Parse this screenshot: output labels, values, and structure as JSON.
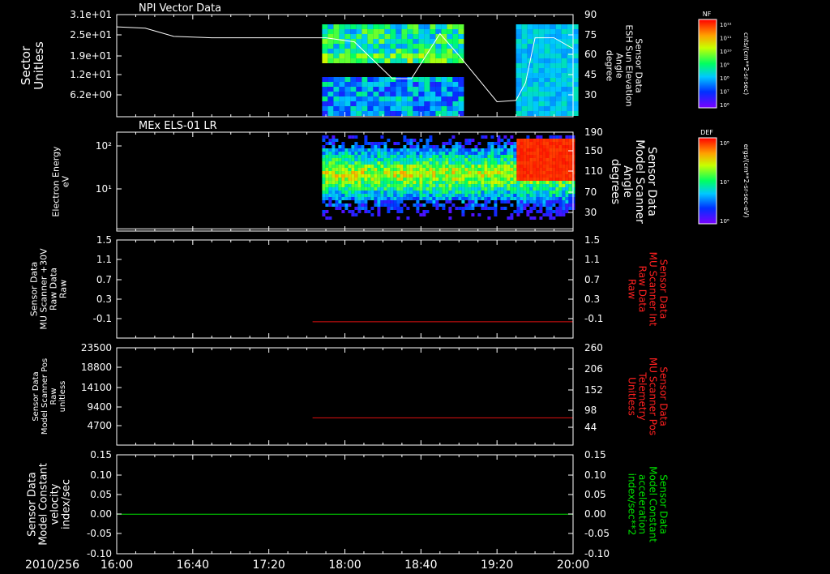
{
  "date_label": "2010/256",
  "x_ticks": [
    "16:00",
    "16:40",
    "17:20",
    "18:00",
    "18:40",
    "19:20",
    "20:00"
  ],
  "colors": {
    "background": "#000000",
    "axes": "#ffffff",
    "red_trace": "#e01010",
    "green_trace": "#00e000",
    "green_label": "#00e000",
    "red_label": "#ff2020"
  },
  "panels": [
    {
      "title": "NPI Vector Data",
      "left_label": [
        "Sector",
        "Unitless"
      ],
      "left_ticks": [
        "3.1e+01",
        "2.5e+01",
        "1.9e+01",
        "1.2e+01",
        "6.2e+00"
      ],
      "right_label": [
        "Sensor Data",
        "ESH Sun Elevation",
        "Angle",
        "degree"
      ],
      "right_ticks": [
        "90",
        "75",
        "60",
        "45",
        "30"
      ],
      "colorbar": {
        "label": "NF",
        "ticks": [
          "10¹²",
          "10¹¹",
          "10¹⁰",
          "10⁹",
          "10⁸",
          "10⁷",
          "10⁶"
        ],
        "units": "cnts/(cm**2-sr-sec)"
      }
    },
    {
      "title": "MEx ELS-01 LR",
      "left_label": [
        "Electron Energy",
        "eV"
      ],
      "left_ticks": [
        "10²",
        "10¹"
      ],
      "right_label": [
        "Sensor Data",
        "Model Scanner",
        "Angle",
        "degrees"
      ],
      "right_ticks": [
        "190",
        "150",
        "110",
        "70",
        "30"
      ],
      "colorbar": {
        "label": "DEF",
        "ticks": [
          "10⁸",
          "10⁷",
          "10⁶"
        ],
        "units": "ergs/(cm**2-sr-sec-eV)"
      }
    },
    {
      "title": "",
      "left_label": [
        "Sensor Data",
        "MU Scanner +30V",
        "Raw Data",
        "Raw"
      ],
      "left_ticks": [
        "1.5",
        "1.1",
        "0.7",
        "0.3",
        "-0.1"
      ],
      "right_label": [
        "Sensor Data",
        "MU Scanner Int",
        "Raw Data",
        "Raw"
      ],
      "right_ticks": [
        "1.5",
        "1.1",
        "0.7",
        "0.3",
        "-0.1"
      ]
    },
    {
      "title": "",
      "left_label": [
        "Sensor Data",
        "Model Scanner Pos",
        "Raw",
        "unitless"
      ],
      "left_ticks": [
        "23500",
        "18800",
        "14100",
        "9400",
        "4700"
      ],
      "right_label": [
        "Sensor Data",
        "MU Scanner Pos",
        "Telemetry",
        "Unitless"
      ],
      "right_ticks": [
        "260",
        "206",
        "152",
        "98",
        "44"
      ]
    },
    {
      "title": "",
      "left_label": [
        "Sensor Data",
        "Model Constant",
        "velocity",
        "index/sec"
      ],
      "left_ticks": [
        "0.15",
        "0.10",
        "0.05",
        "0.00",
        "-0.05",
        "-0.10"
      ],
      "right_label": [
        "Sensor Data",
        "Model Constant",
        "acceleration",
        "index/sec**2"
      ],
      "right_ticks": [
        "0.15",
        "0.10",
        "0.05",
        "0.00",
        "-0.05",
        "-0.10"
      ]
    }
  ],
  "chart_data": [
    {
      "type": "heatmap",
      "title": "NPI Vector Data",
      "x_range": [
        "16:00",
        "20:00"
      ],
      "y_ticks": [
        "3.1e+01",
        "2.5e+01",
        "1.9e+01",
        "1.2e+01",
        "6.2e+00"
      ],
      "data_windows": [
        [
          "17:48",
          "19:00"
        ],
        [
          "19:30",
          "20:00"
        ]
      ],
      "overlay_line": {
        "name": "ESH Sun Elevation Angle",
        "y_range": [
          15,
          90
        ],
        "x": [
          "16:00",
          "16:15",
          "16:30",
          "16:50",
          "17:50",
          "18:05",
          "18:25",
          "18:35",
          "18:50",
          "19:00",
          "19:20",
          "19:30",
          "19:35",
          "19:40",
          "19:50",
          "20:00"
        ],
        "y": [
          81,
          80,
          74,
          73,
          73,
          70,
          43,
          43,
          76,
          60,
          26,
          27,
          40,
          73,
          73,
          65
        ]
      }
    },
    {
      "type": "heatmap",
      "title": "MEx ELS-01 LR",
      "x_range": [
        "16:00",
        "20:00"
      ],
      "data_window": [
        "17:48",
        "20:00"
      ],
      "overlay_line": {
        "name": "Model Scanner Angle",
        "y_range": [
          10,
          190
        ],
        "value": 14
      }
    },
    {
      "type": "line",
      "series": [
        {
          "name": "MU Scanner Int Raw Data",
          "x": [
            "17:43",
            "20:00"
          ],
          "y": [
            0,
            0
          ]
        }
      ],
      "y_range": [
        -0.3,
        1.5
      ]
    },
    {
      "type": "line",
      "series": [
        {
          "name": "MU Scanner Pos Telemetry",
          "x": [
            "17:43",
            "20:00"
          ],
          "y": [
            85,
            85
          ]
        }
      ],
      "y_range": [
        17,
        260
      ]
    },
    {
      "type": "line",
      "series": [
        {
          "name": "Model Constant velocity",
          "x": [
            "16:00",
            "20:00"
          ],
          "y": [
            0,
            0
          ]
        }
      ],
      "y_range": [
        -0.1,
        0.15
      ]
    }
  ]
}
